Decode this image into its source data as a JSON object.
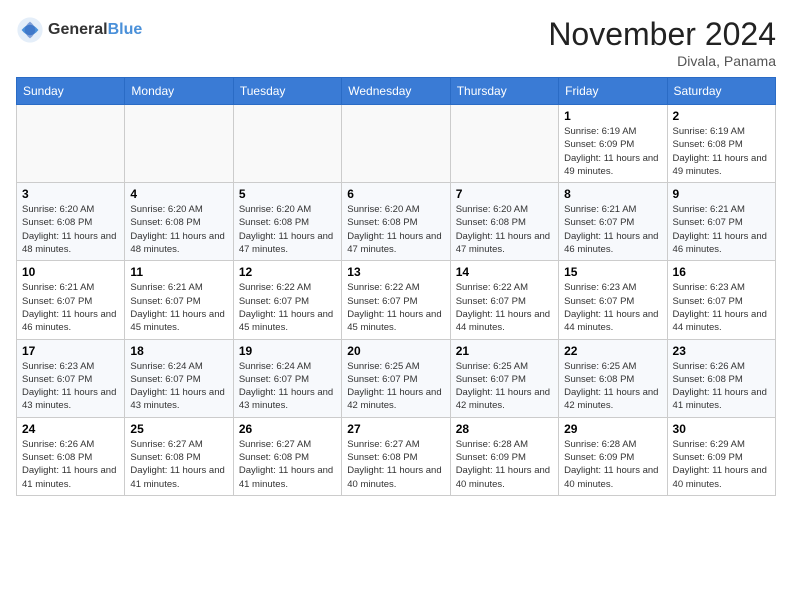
{
  "header": {
    "logo_general": "General",
    "logo_blue": "Blue",
    "month_title": "November 2024",
    "location": "Divala, Panama"
  },
  "weekdays": [
    "Sunday",
    "Monday",
    "Tuesday",
    "Wednesday",
    "Thursday",
    "Friday",
    "Saturday"
  ],
  "weeks": [
    [
      {
        "day": "",
        "info": ""
      },
      {
        "day": "",
        "info": ""
      },
      {
        "day": "",
        "info": ""
      },
      {
        "day": "",
        "info": ""
      },
      {
        "day": "",
        "info": ""
      },
      {
        "day": "1",
        "info": "Sunrise: 6:19 AM\nSunset: 6:09 PM\nDaylight: 11 hours and 49 minutes."
      },
      {
        "day": "2",
        "info": "Sunrise: 6:19 AM\nSunset: 6:08 PM\nDaylight: 11 hours and 49 minutes."
      }
    ],
    [
      {
        "day": "3",
        "info": "Sunrise: 6:20 AM\nSunset: 6:08 PM\nDaylight: 11 hours and 48 minutes."
      },
      {
        "day": "4",
        "info": "Sunrise: 6:20 AM\nSunset: 6:08 PM\nDaylight: 11 hours and 48 minutes."
      },
      {
        "day": "5",
        "info": "Sunrise: 6:20 AM\nSunset: 6:08 PM\nDaylight: 11 hours and 47 minutes."
      },
      {
        "day": "6",
        "info": "Sunrise: 6:20 AM\nSunset: 6:08 PM\nDaylight: 11 hours and 47 minutes."
      },
      {
        "day": "7",
        "info": "Sunrise: 6:20 AM\nSunset: 6:08 PM\nDaylight: 11 hours and 47 minutes."
      },
      {
        "day": "8",
        "info": "Sunrise: 6:21 AM\nSunset: 6:07 PM\nDaylight: 11 hours and 46 minutes."
      },
      {
        "day": "9",
        "info": "Sunrise: 6:21 AM\nSunset: 6:07 PM\nDaylight: 11 hours and 46 minutes."
      }
    ],
    [
      {
        "day": "10",
        "info": "Sunrise: 6:21 AM\nSunset: 6:07 PM\nDaylight: 11 hours and 46 minutes."
      },
      {
        "day": "11",
        "info": "Sunrise: 6:21 AM\nSunset: 6:07 PM\nDaylight: 11 hours and 45 minutes."
      },
      {
        "day": "12",
        "info": "Sunrise: 6:22 AM\nSunset: 6:07 PM\nDaylight: 11 hours and 45 minutes."
      },
      {
        "day": "13",
        "info": "Sunrise: 6:22 AM\nSunset: 6:07 PM\nDaylight: 11 hours and 45 minutes."
      },
      {
        "day": "14",
        "info": "Sunrise: 6:22 AM\nSunset: 6:07 PM\nDaylight: 11 hours and 44 minutes."
      },
      {
        "day": "15",
        "info": "Sunrise: 6:23 AM\nSunset: 6:07 PM\nDaylight: 11 hours and 44 minutes."
      },
      {
        "day": "16",
        "info": "Sunrise: 6:23 AM\nSunset: 6:07 PM\nDaylight: 11 hours and 44 minutes."
      }
    ],
    [
      {
        "day": "17",
        "info": "Sunrise: 6:23 AM\nSunset: 6:07 PM\nDaylight: 11 hours and 43 minutes."
      },
      {
        "day": "18",
        "info": "Sunrise: 6:24 AM\nSunset: 6:07 PM\nDaylight: 11 hours and 43 minutes."
      },
      {
        "day": "19",
        "info": "Sunrise: 6:24 AM\nSunset: 6:07 PM\nDaylight: 11 hours and 43 minutes."
      },
      {
        "day": "20",
        "info": "Sunrise: 6:25 AM\nSunset: 6:07 PM\nDaylight: 11 hours and 42 minutes."
      },
      {
        "day": "21",
        "info": "Sunrise: 6:25 AM\nSunset: 6:07 PM\nDaylight: 11 hours and 42 minutes."
      },
      {
        "day": "22",
        "info": "Sunrise: 6:25 AM\nSunset: 6:08 PM\nDaylight: 11 hours and 42 minutes."
      },
      {
        "day": "23",
        "info": "Sunrise: 6:26 AM\nSunset: 6:08 PM\nDaylight: 11 hours and 41 minutes."
      }
    ],
    [
      {
        "day": "24",
        "info": "Sunrise: 6:26 AM\nSunset: 6:08 PM\nDaylight: 11 hours and 41 minutes."
      },
      {
        "day": "25",
        "info": "Sunrise: 6:27 AM\nSunset: 6:08 PM\nDaylight: 11 hours and 41 minutes."
      },
      {
        "day": "26",
        "info": "Sunrise: 6:27 AM\nSunset: 6:08 PM\nDaylight: 11 hours and 41 minutes."
      },
      {
        "day": "27",
        "info": "Sunrise: 6:27 AM\nSunset: 6:08 PM\nDaylight: 11 hours and 40 minutes."
      },
      {
        "day": "28",
        "info": "Sunrise: 6:28 AM\nSunset: 6:09 PM\nDaylight: 11 hours and 40 minutes."
      },
      {
        "day": "29",
        "info": "Sunrise: 6:28 AM\nSunset: 6:09 PM\nDaylight: 11 hours and 40 minutes."
      },
      {
        "day": "30",
        "info": "Sunrise: 6:29 AM\nSunset: 6:09 PM\nDaylight: 11 hours and 40 minutes."
      }
    ]
  ]
}
